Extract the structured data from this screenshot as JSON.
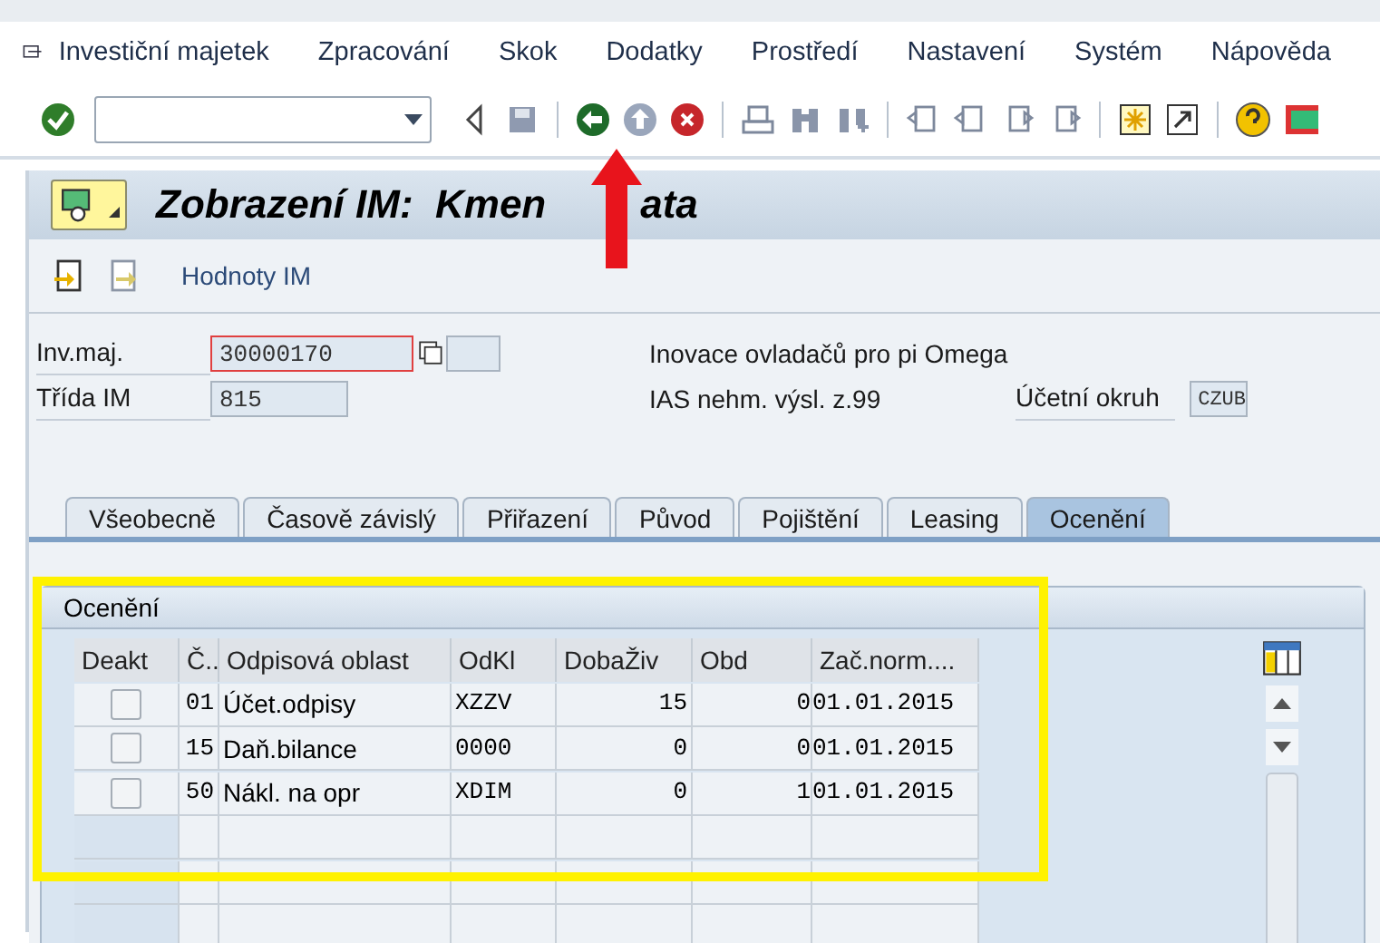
{
  "menu": [
    "Investiční majetek",
    "Zpracování",
    "Skok",
    "Dodatky",
    "Prostředí",
    "Nastavení",
    "Systém",
    "Nápověda"
  ],
  "title": {
    "before_arrow": "Zobrazení IM:  Kmen",
    "after_arrow": "ata"
  },
  "app_toolbar": {
    "button": "Hodnoty IM"
  },
  "fields": {
    "inv_maj": {
      "label": "Inv.maj.",
      "value": "30000170"
    },
    "trida": {
      "label": "Třída IM",
      "value": "815"
    },
    "description": "Inovace ovladačů pro pi Omega",
    "class_text": "IAS nehm. výsl. z.99",
    "okruh": {
      "label": "Účetní okruh",
      "value": "CZUB"
    }
  },
  "tabs": [
    {
      "label": "Všeobecně",
      "selected": false
    },
    {
      "label": "Časově závislý",
      "selected": false
    },
    {
      "label": "Přiřazení",
      "selected": false
    },
    {
      "label": "Původ",
      "selected": false
    },
    {
      "label": "Pojištění",
      "selected": false
    },
    {
      "label": "Leasing",
      "selected": false
    },
    {
      "label": "Ocenění",
      "selected": true
    }
  ],
  "group": {
    "title": "Ocenění"
  },
  "table": {
    "columns": [
      "Deakt",
      "Č..",
      "Odpisová oblast",
      "OdKl",
      "DobaŽiv",
      "Obd",
      "Zač.norm...."
    ],
    "rows": [
      {
        "checked": false,
        "number": "01",
        "area": "Účet.odpisy",
        "odkl": "XZZV",
        "doba": "15",
        "obd": "0",
        "zac": "01.01.2015"
      },
      {
        "checked": false,
        "number": "15",
        "area": "Daň.bilance",
        "odkl": "0000",
        "doba": "0",
        "obd": "0",
        "zac": "01.01.2015"
      },
      {
        "checked": false,
        "number": "50",
        "area": "Nákl. na opr",
        "odkl": "XDIM",
        "doba": "0",
        "obd": "1",
        "zac": "01.01.2015"
      }
    ]
  }
}
